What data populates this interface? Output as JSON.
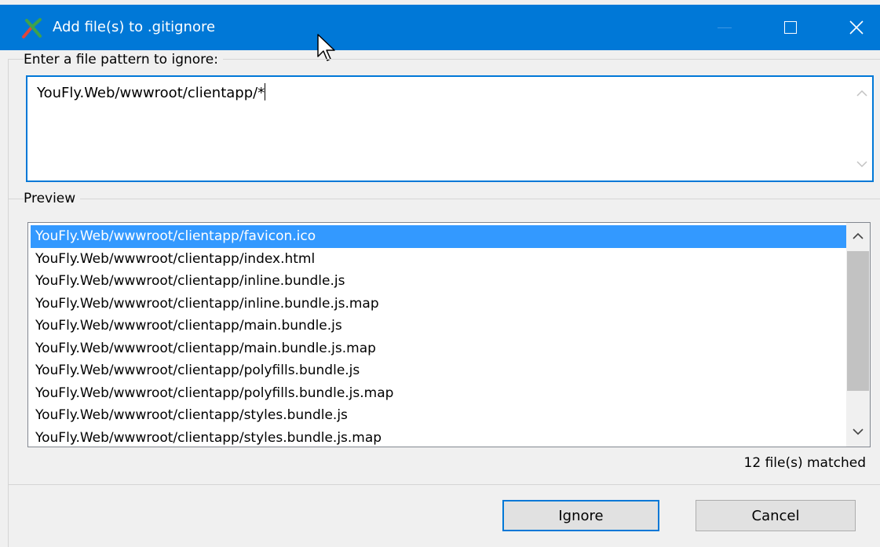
{
  "window": {
    "title": "Add file(s) to .gitignore",
    "accent_color": "#0078d7",
    "controls": [
      "minimize-icon",
      "maximize-icon",
      "close-icon"
    ]
  },
  "pattern_section": {
    "label": "Enter a file pattern to ignore:",
    "value": "YouFly.Web/wwwroot/clientapp/*"
  },
  "preview_section": {
    "label": "Preview",
    "selected_index": 0,
    "items": [
      "YouFly.Web/wwwroot/clientapp/favicon.ico",
      "YouFly.Web/wwwroot/clientapp/index.html",
      "YouFly.Web/wwwroot/clientapp/inline.bundle.js",
      "YouFly.Web/wwwroot/clientapp/inline.bundle.js.map",
      "YouFly.Web/wwwroot/clientapp/main.bundle.js",
      "YouFly.Web/wwwroot/clientapp/main.bundle.js.map",
      "YouFly.Web/wwwroot/clientapp/polyfills.bundle.js",
      "YouFly.Web/wwwroot/clientapp/polyfills.bundle.js.map",
      "YouFly.Web/wwwroot/clientapp/styles.bundle.js",
      "YouFly.Web/wwwroot/clientapp/styles.bundle.js.map"
    ]
  },
  "status": {
    "matched_text": "12 file(s) matched"
  },
  "buttons": {
    "ignore_label": "Ignore",
    "cancel_label": "Cancel"
  }
}
